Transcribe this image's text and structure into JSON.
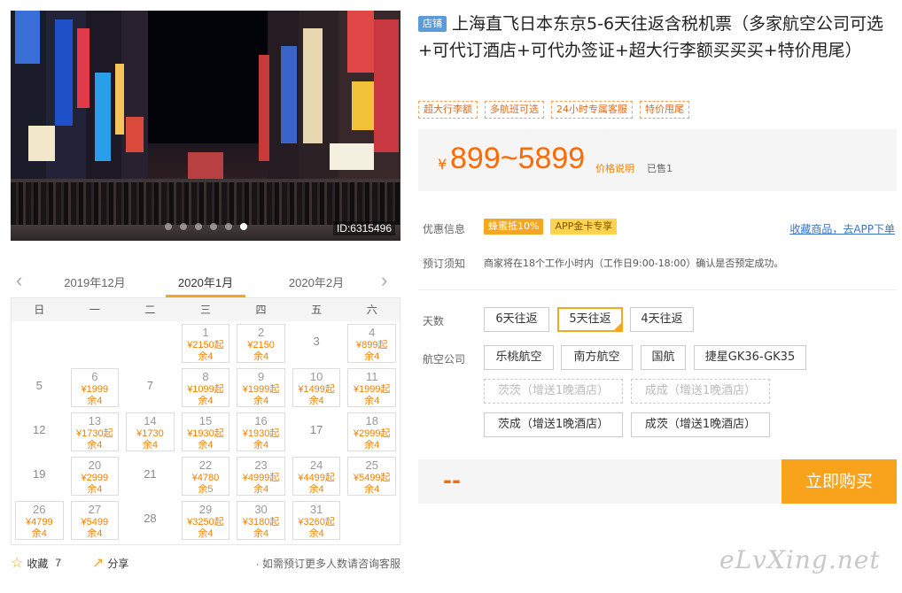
{
  "photo": {
    "id_label": "ID:6315496",
    "dots": 6,
    "active_dot": 5
  },
  "calendar": {
    "prev_month": "2019年12月",
    "current_month": "2020年1月",
    "next_month": "2020年2月",
    "weekdays": [
      "日",
      "一",
      "二",
      "三",
      "四",
      "五",
      "六"
    ],
    "rows": [
      [
        null,
        null,
        null,
        {
          "d": "1",
          "p": "¥2150起",
          "s": "余4"
        },
        {
          "d": "2",
          "p": "¥2150",
          "s": "余4"
        },
        {
          "d": "3"
        },
        {
          "d": "4",
          "p": "¥899起",
          "s": "余4"
        }
      ],
      [
        {
          "d": "5"
        },
        {
          "d": "6",
          "p": "¥1999",
          "s": "余4"
        },
        {
          "d": "7"
        },
        {
          "d": "8",
          "p": "¥1099起",
          "s": "余4"
        },
        {
          "d": "9",
          "p": "¥1999起",
          "s": "余4"
        },
        {
          "d": "10",
          "p": "¥1499起",
          "s": "余4"
        },
        {
          "d": "11",
          "p": "¥1999起",
          "s": "余4"
        }
      ],
      [
        {
          "d": "12"
        },
        {
          "d": "13",
          "p": "¥1730起",
          "s": "余4"
        },
        {
          "d": "14",
          "p": "¥1730",
          "s": "余4"
        },
        {
          "d": "15",
          "p": "¥1930起",
          "s": "余4"
        },
        {
          "d": "16",
          "p": "¥1930起",
          "s": "余4"
        },
        {
          "d": "17"
        },
        {
          "d": "18",
          "p": "¥2999起",
          "s": "余4"
        }
      ],
      [
        {
          "d": "19"
        },
        {
          "d": "20",
          "p": "¥2999",
          "s": "余4"
        },
        {
          "d": "21"
        },
        {
          "d": "22",
          "p": "¥4780",
          "s": "余5"
        },
        {
          "d": "23",
          "p": "¥4999起",
          "s": "余4"
        },
        {
          "d": "24",
          "p": "¥4499起",
          "s": "余4"
        },
        {
          "d": "25",
          "p": "¥5499起",
          "s": "余4"
        }
      ],
      [
        {
          "d": "26",
          "p": "¥4799",
          "s": "余4"
        },
        {
          "d": "27",
          "p": "¥5499",
          "s": "余4"
        },
        {
          "d": "28"
        },
        {
          "d": "29",
          "p": "¥3250起",
          "s": "余4"
        },
        {
          "d": "30",
          "p": "¥3180起",
          "s": "余4"
        },
        {
          "d": "31",
          "p": "¥3260起",
          "s": "余4"
        },
        null
      ]
    ]
  },
  "bottom": {
    "favorite_label": "收藏",
    "favorite_count": "7",
    "share_label": "分享",
    "note": "· 如需预订更多人数请咨询客服"
  },
  "product": {
    "shop_badge": "店铺",
    "title": "上海直飞日本东京5-6天往返含税机票（多家航空公司可选+可代订酒店+可代办签证+超大行李额买买买+特价甩尾）",
    "tags": [
      "超大行李额",
      "多航班可选",
      "24小时专属客服",
      "特价甩尾"
    ],
    "currency": "¥",
    "price": "899~5899",
    "price_explain": "价格说明",
    "sold": "已售1"
  },
  "info": {
    "promo_label": "优惠信息",
    "promo_badges": [
      "蜂蜜抵10%",
      "APP金卡专享"
    ],
    "fav_link": "收藏商品，去APP下单",
    "notice_label": "预订须知",
    "notice_text": "商家将在18个工作小时内（工作日9:00-18:00）确认是否预定成功。"
  },
  "options": {
    "days_label": "天数",
    "days": [
      "6天往返",
      "5天往返",
      "4天往返"
    ],
    "days_selected": 1,
    "airline_label": "航空公司",
    "airlines_row1": [
      "乐桃航空",
      "南方航空",
      "国航",
      "捷星GK36-GK35"
    ],
    "airlines_row2": [
      "茨茨（增送1晚酒店）",
      "成成（增送1晚酒店）"
    ],
    "airlines_row3": [
      "茨成（增送1晚酒店）",
      "成茨（增送1晚酒店）"
    ]
  },
  "buy": {
    "total": "--",
    "button": "立即购买"
  },
  "watermark": "eLvXing.net",
  "colors": {
    "accent": "#f9a21b",
    "price": "#ff6a00",
    "link": "#3a73c8"
  }
}
